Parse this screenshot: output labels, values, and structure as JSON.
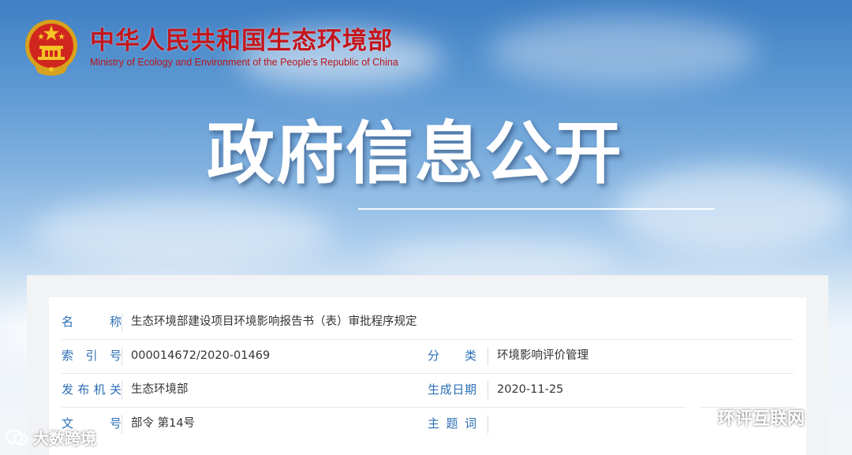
{
  "header": {
    "org_cn": "中华人民共和国生态环境部",
    "org_en": "Ministry of Ecology and Environment of the People's Republic of China",
    "emblem_icon": "national-emblem-icon"
  },
  "banner": {
    "title": "政府信息公开"
  },
  "info": {
    "name_label": "名　　称",
    "name_value": "生态环境部建设项目环境影响报告书（表）审批程序规定",
    "index_label": "索 引 号",
    "index_value": "000014672/2020-01469",
    "category_label": "分　　类",
    "category_value": "环境影响评价管理",
    "issuer_label": "发布机关",
    "issuer_value": "生态环境部",
    "date_label": "生成日期",
    "date_value": "2020-11-25",
    "docno_label": "文　　号",
    "docno_value": "部令 第14号",
    "subject_label": "主 题 词",
    "subject_value": ""
  },
  "watermarks": {
    "left": "大数跨境",
    "right": "环评互联网"
  },
  "colors": {
    "brand_red": "#c4161c",
    "label_blue": "#2d6fb5",
    "value_text": "#333333"
  }
}
